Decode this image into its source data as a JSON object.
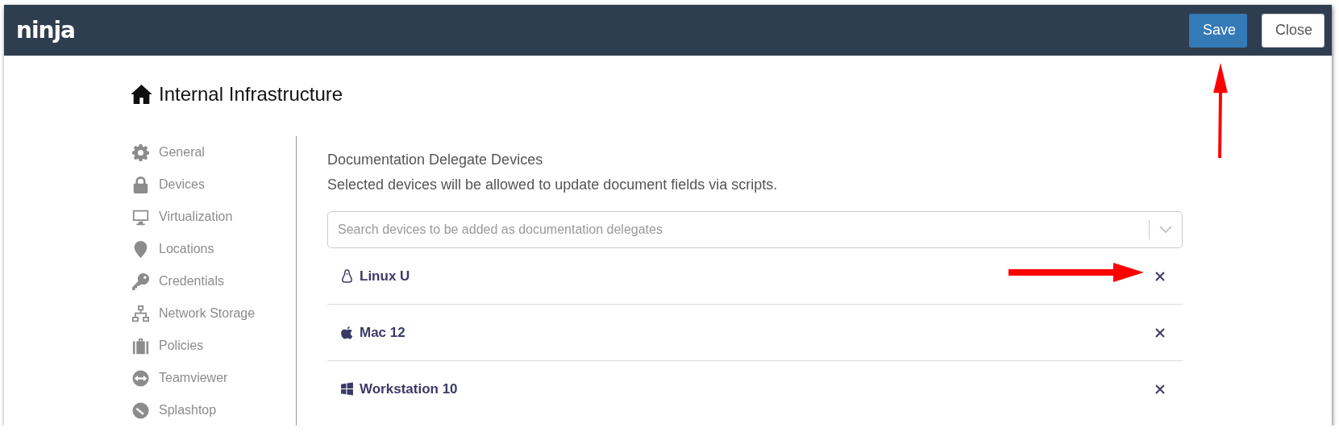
{
  "header": {
    "logo": "ninja",
    "buttons": [
      {
        "label": "Save",
        "kind": "primary"
      },
      {
        "label": "Close",
        "kind": "secondary"
      }
    ]
  },
  "page_title": "Internal Infrastructure",
  "sidebar": {
    "items": [
      {
        "label": "General",
        "kind": "gear"
      },
      {
        "label": "Devices",
        "kind": "lock"
      },
      {
        "label": "Virtualization",
        "kind": "monitor"
      },
      {
        "label": "Locations",
        "kind": "pin"
      },
      {
        "label": "Credentials",
        "kind": "key"
      },
      {
        "label": "Network Storage",
        "kind": "network"
      },
      {
        "label": "Policies",
        "kind": "briefcase"
      },
      {
        "label": "Teamviewer",
        "kind": "teamviewer"
      },
      {
        "label": "Splashtop",
        "kind": "splashtop"
      }
    ]
  },
  "section": {
    "title": "Documentation Delegate Devices",
    "description": "Selected devices will be allowed to update document fields via scripts.",
    "search": {
      "placeholder": "Search devices to be added as documentation delegates"
    },
    "devices": [
      {
        "name": "Linux U",
        "kind": "linux"
      },
      {
        "name": "Mac 12",
        "kind": "mac"
      },
      {
        "name": "Workstation 10",
        "kind": "windows"
      }
    ]
  }
}
